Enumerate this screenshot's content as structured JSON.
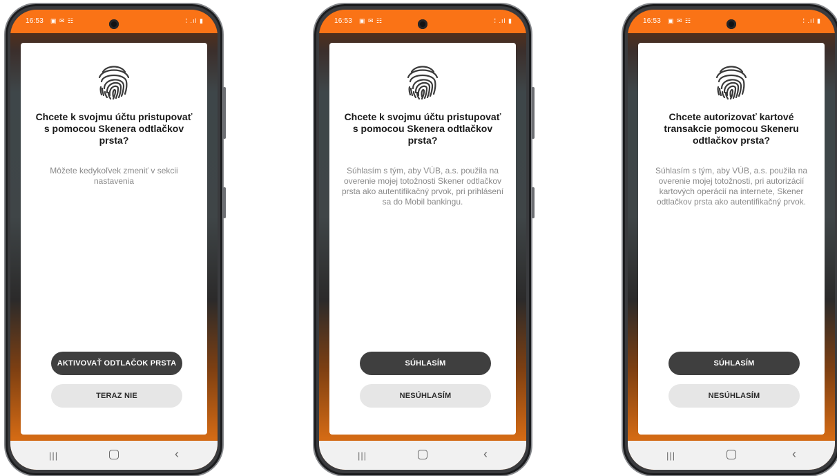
{
  "status": {
    "time": "16:53",
    "notifications": "▣ ✉ ☷",
    "system_icons": "⁞ .ıl ▮"
  },
  "colors": {
    "status_bar": "#fa7316",
    "primary_button": "#3f3f3f",
    "secondary_button": "#e6e6e6"
  },
  "screens": [
    {
      "title": "Chcete k svojmu účtu pristupovať s pomocou Skenera odtlačkov prsta?",
      "description": "Môžete kedykoľvek zmeniť v sekcii nastavenia",
      "primary_button": "AKTIVOVAŤ ODTLAČOK PRSTA",
      "secondary_button": "TERAZ NIE"
    },
    {
      "title": "Chcete k svojmu účtu pristupovať s pomocou Skenera odtlačkov prsta?",
      "description": "Súhlasím s tým, aby VÚB, a.s. použila na overenie mojej totožnosti Skener odtlačkov prsta ako autentifikačný prvok, pri prihlásení sa do Mobil bankingu.",
      "primary_button": "SÚHLASÍM",
      "secondary_button": "NESÚHLASÍM"
    },
    {
      "title": "Chcete autorizovať kartové transakcie pomocou Skeneru odtlačkov prsta?",
      "description": "Súhlasím s tým, aby VÚB, a.s. použila na overenie mojej totožnosti, pri autorizácií kartových operácií na internete, Skener odtlačkov prsta ako autentifikačný prvok.",
      "primary_button": "SÚHLASÍM",
      "secondary_button": "NESÚHLASÍM"
    }
  ],
  "navbar": {
    "recents_icon": "recents-icon",
    "home_icon": "home-icon",
    "back_icon": "back-icon",
    "recents_glyph": "|||",
    "back_glyph": "‹"
  }
}
